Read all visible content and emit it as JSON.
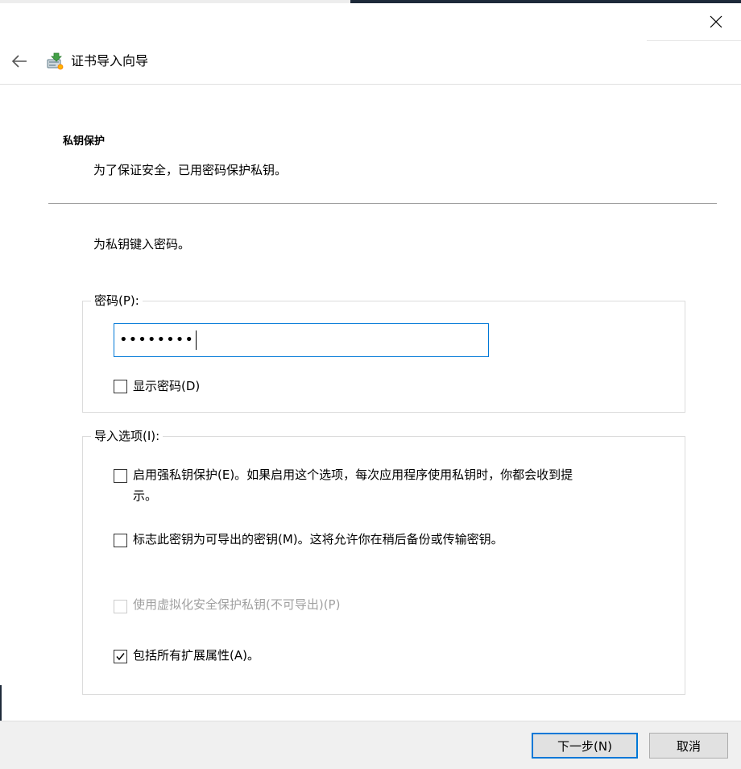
{
  "window": {
    "wizard_title": "证书导入向导"
  },
  "page": {
    "section_title": "私钥保护",
    "section_subtitle": "为了保证安全，已用密码保护私钥。",
    "prompt": "为私钥键入密码。"
  },
  "password_group": {
    "legend": "密码(P):",
    "value": "••••••••",
    "show_password_label": "显示密码(D)",
    "show_password_checked": false
  },
  "options_group": {
    "legend": "导入选项(I):",
    "options": [
      {
        "label_line1": "启用强私钥保护(E)。如果启用这个选项，每次应用程序使用私钥时，你都会收到提",
        "label_line2": "示。",
        "checked": false,
        "disabled": false
      },
      {
        "label_line1": "标志此密钥为可导出的密钥(M)。这将允许你在稍后备份或传输密钥。",
        "checked": false,
        "disabled": false
      },
      {
        "label_line1": "使用虚拟化安全保护私钥(不可导出)(P)",
        "checked": false,
        "disabled": true
      },
      {
        "label_line1": "包括所有扩展属性(A)。",
        "checked": true,
        "disabled": false
      }
    ]
  },
  "footer": {
    "next_label": "下一步(N)",
    "cancel_label": "取消"
  },
  "colors": {
    "accent": "#0078d7",
    "footer_bg": "#f0f0f0",
    "disabled_text": "#a0a0a0"
  }
}
